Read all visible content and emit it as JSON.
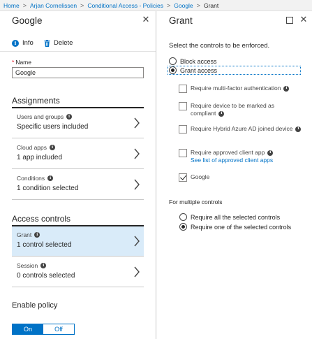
{
  "breadcrumb": {
    "items": [
      "Home",
      "Arjan Cornelissen",
      "Conditional Access - Policies",
      "Google"
    ],
    "current": "Grant",
    "separator": ">"
  },
  "left_blade": {
    "title": "Google",
    "commands": {
      "info": "Info",
      "delete": "Delete"
    },
    "name_label": "Name",
    "name_value": "Google",
    "assignments_title": "Assignments",
    "assignments": [
      {
        "label": "Users and groups",
        "value": "Specific users included"
      },
      {
        "label": "Cloud apps",
        "value": "1 app included"
      },
      {
        "label": "Conditions",
        "value": "1 condition selected"
      }
    ],
    "access_controls_title": "Access controls",
    "access_controls": [
      {
        "label": "Grant",
        "value": "1 control selected",
        "selected": true
      },
      {
        "label": "Session",
        "value": "0 controls selected",
        "selected": false
      }
    ],
    "enable_policy_title": "Enable policy",
    "toggle": {
      "on": "On",
      "off": "Off",
      "state": "On"
    }
  },
  "right_blade": {
    "title": "Grant",
    "instruction": "Select the controls to be enforced.",
    "access_options": [
      {
        "label": "Block access",
        "checked": false
      },
      {
        "label": "Grant access",
        "checked": true
      }
    ],
    "controls": [
      {
        "label": "Require multi-factor authentication",
        "checked": false
      },
      {
        "label": "Require device to be marked as compliant",
        "checked": false
      },
      {
        "label": "Require Hybrid Azure AD joined device",
        "checked": false
      },
      {
        "label": "Require approved client app",
        "link": "See list of approved client apps",
        "checked": false
      },
      {
        "label": "Google",
        "checked": true
      }
    ],
    "multiple_title": "For multiple controls",
    "multiple_options": [
      {
        "label": "Require all the selected controls",
        "checked": false
      },
      {
        "label": "Require one of the selected controls",
        "checked": true
      }
    ]
  },
  "colors": {
    "accent": "#0072c6",
    "selected_row": "#d9ebf9",
    "breadcrumb_bg": "#f2f2f2"
  },
  "icons": {
    "info": "info-icon",
    "delete": "trash-icon",
    "close": "close-icon",
    "maximize": "maximize-icon",
    "chevron": "chevron-right-icon"
  }
}
